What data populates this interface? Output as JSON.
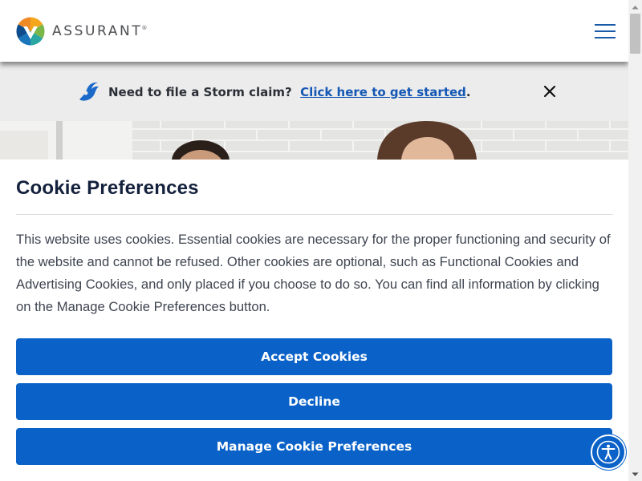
{
  "header": {
    "brand": "ASSURANT",
    "brand_mark": "®",
    "logo_icon": "assurant-logo-icon",
    "menu_icon": "hamburger-menu-icon"
  },
  "alert": {
    "icon": "storm-wave-icon",
    "text": "Need to file a Storm claim?",
    "link_label": "Click here to get started",
    "suffix": ".",
    "close_icon": "close-icon"
  },
  "cookie": {
    "title": "Cookie Preferences",
    "body": "This website uses cookies. Essential cookies are necessary for the proper functioning and security of the website and cannot be refused. Other cookies are optional, such as Functional Cookies and Advertising Cookies, and only placed if you choose to do so. You can find all information by clicking on the Manage Cookie Preferences button.",
    "accept_label": "Accept Cookies",
    "decline_label": "Decline",
    "manage_label": "Manage Cookie Preferences"
  },
  "accessibility": {
    "icon": "accessibility-icon"
  },
  "colors": {
    "primary_button": "#0a62c8",
    "link": "#1457b4",
    "menu_icon": "#1a5ba8",
    "banner_background": "#ececec",
    "title_text": "#14213d"
  }
}
